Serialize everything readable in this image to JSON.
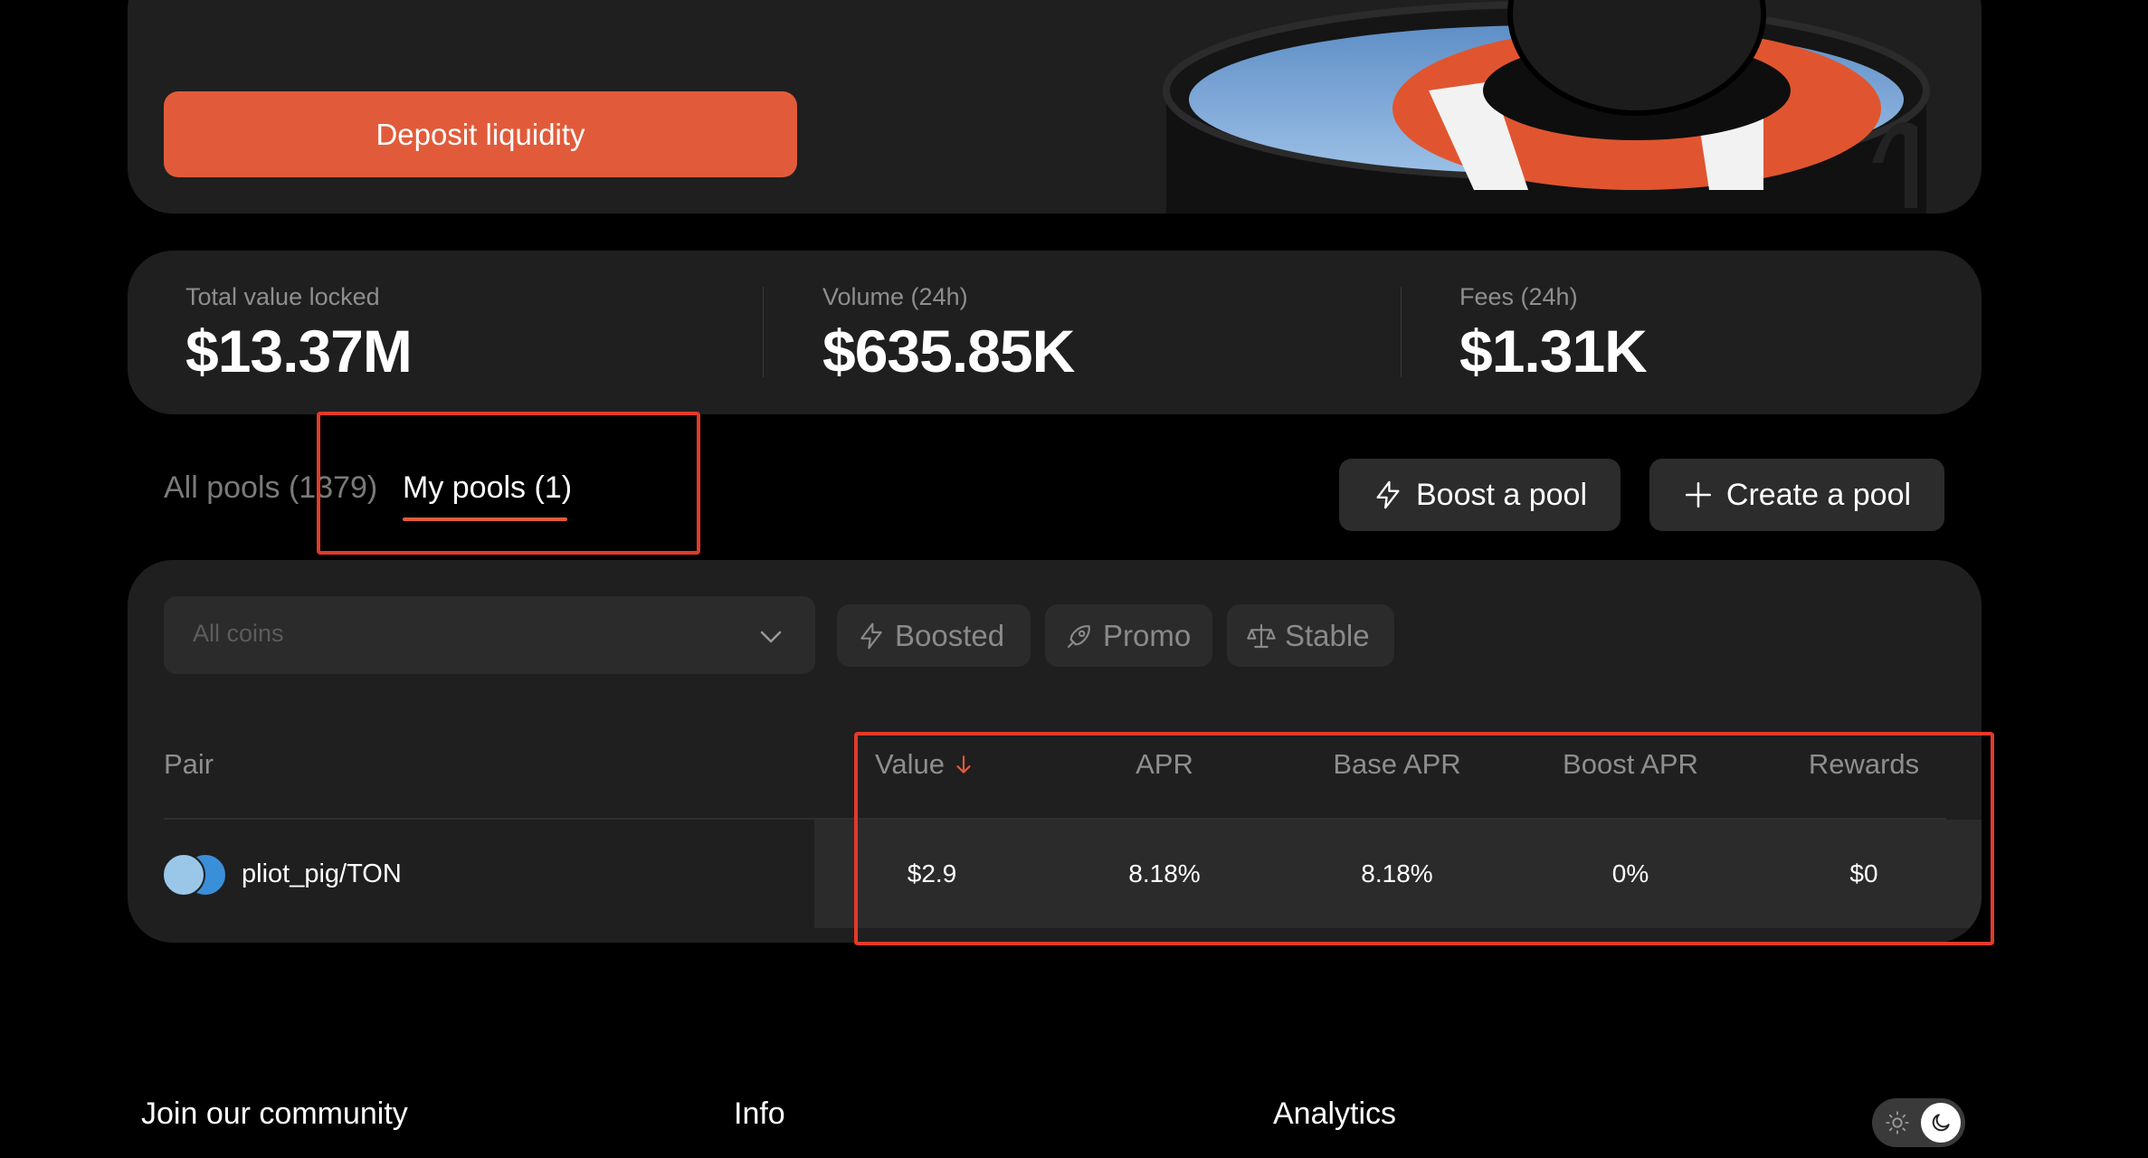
{
  "hero": {
    "deposit_label": "Deposit liquidity"
  },
  "stats": [
    {
      "label": "Total value locked",
      "value": "$13.37M"
    },
    {
      "label": "Volume (24h)",
      "value": "$635.85K"
    },
    {
      "label": "Fees (24h)",
      "value": "$1.31K"
    }
  ],
  "tabs": {
    "all_pools": "All pools (1379)",
    "my_pools": "My pools (1)"
  },
  "actions": {
    "boost": "Boost a pool",
    "create": "Create a pool"
  },
  "filters": {
    "coin_placeholder": "All coins",
    "chips": [
      "Boosted",
      "Promo",
      "Stable"
    ]
  },
  "table": {
    "headers": {
      "pair": "Pair",
      "value": "Value",
      "apr": "APR",
      "base_apr": "Base APR",
      "boost_apr": "Boost APR",
      "rewards": "Rewards"
    },
    "rows": [
      {
        "pair": "pliot_pig/TON",
        "value": "$2.9",
        "apr": "8.18%",
        "base_apr": "8.18%",
        "boost_apr": "0%",
        "rewards": "$0"
      }
    ]
  },
  "footer": {
    "community": "Join our community",
    "info": "Info",
    "analytics": "Analytics"
  },
  "colors": {
    "accent": "#e15b3a",
    "highlight_box": "#e33a29",
    "panel": "#1f1f1f",
    "background": "#000000"
  },
  "icons": [
    "chevron-down-icon",
    "lightning-icon",
    "rocket-icon",
    "scales-icon",
    "plus-icon",
    "arrow-down-icon",
    "sun-icon",
    "moon-icon"
  ]
}
